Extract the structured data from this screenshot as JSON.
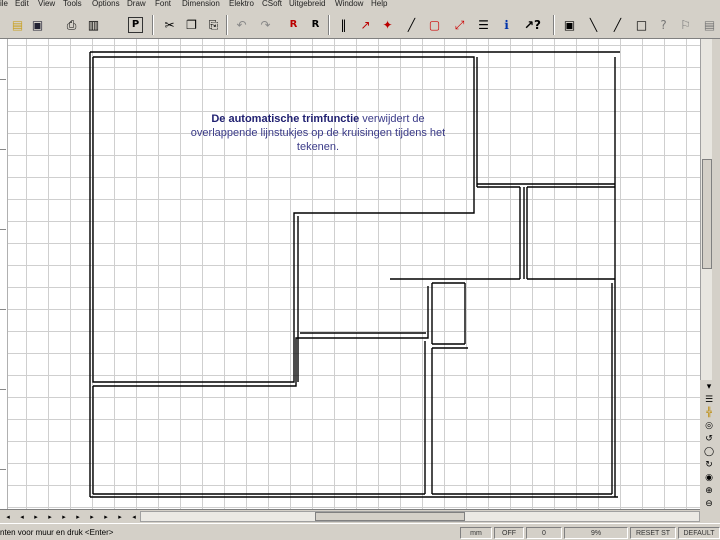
{
  "menu": [
    "ile",
    "Edit",
    "View",
    "Tools",
    "Options",
    "Draw",
    "Font",
    "Dimension",
    "Elektro",
    "CSoft",
    "Uitgebreid",
    "Window",
    "Help"
  ],
  "toolbar_icons": [
    "folder-open-icon",
    "save-icon",
    "print-icon",
    "print-preview-icon",
    "cut-icon",
    "copy-icon",
    "paste-icon",
    "undo-icon",
    "redo-icon",
    "redraw-icon",
    "refresh-icon",
    "wall-icon",
    "line-icon",
    "arc-icon",
    "select-icon",
    "dimension-icon",
    "window-icon",
    "info-icon",
    "help-icon",
    "zoom-window-icon",
    "zoom-icon",
    "pan-icon",
    "view-icon",
    "question-icon",
    "text-icon"
  ],
  "caption": {
    "bold": "De automatische trimfunctie",
    "rest": " verwijdert de overlappende lijnstukjes op de kruisingen tijdens het tekenen."
  },
  "status": {
    "prompt": "nten voor muur en druk <Enter>",
    "unit": "mm",
    "mode": "OFF",
    "value": "0",
    "zoom": "9%",
    "reset": "RESET ST",
    "default": "DEFAULT"
  }
}
